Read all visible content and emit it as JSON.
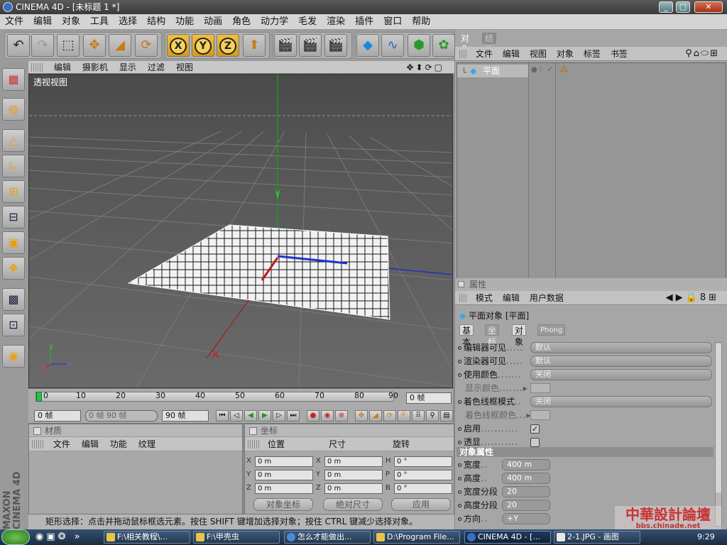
{
  "window": {
    "title": "CINEMA 4D - [未标题 1 *]"
  },
  "menubar": [
    "文件",
    "编辑",
    "对象",
    "工具",
    "选择",
    "结构",
    "功能",
    "动画",
    "角色",
    "动力学",
    "毛发",
    "渲染",
    "插件",
    "窗口",
    "帮助"
  ],
  "viewport": {
    "menu": [
      "编辑",
      "摄影机",
      "显示",
      "过滤",
      "视图"
    ],
    "label": "透视视图",
    "axes": {
      "x": "x",
      "y": "y",
      "z": "z"
    }
  },
  "timeline": {
    "ticks": [
      "0",
      "10",
      "20",
      "30",
      "40",
      "50",
      "60",
      "70",
      "80",
      "90"
    ],
    "current_frame": "0 帧"
  },
  "playback": {
    "start": "0 帧",
    "range": "0 帧  90 帧",
    "end": "90 帧"
  },
  "materials": {
    "title": "材质",
    "menu": [
      "文件",
      "编辑",
      "功能",
      "纹理"
    ]
  },
  "coordinates": {
    "title": "坐标",
    "headers": [
      "位置",
      "尺寸",
      "旋转"
    ],
    "rows": [
      {
        "a": "X",
        "v1": "0 m",
        "b": "X",
        "v2": "0 m",
        "c": "H",
        "v3": "0 °"
      },
      {
        "a": "Y",
        "v1": "0 m",
        "b": "Y",
        "v2": "0 m",
        "c": "P",
        "v3": "0 °"
      },
      {
        "a": "Z",
        "v1": "0 m",
        "b": "Z",
        "v2": "0 m",
        "c": "B",
        "v3": "0 °"
      }
    ],
    "mode": "对象坐标",
    "size_mode": "绝对尺寸",
    "apply": "应用"
  },
  "objects": {
    "tabs": [
      "对象",
      "结构"
    ],
    "menu": [
      "文件",
      "编辑",
      "视图",
      "对象",
      "标签",
      "书签"
    ],
    "items": [
      "平面"
    ]
  },
  "attributes": {
    "title": "属性",
    "menu": [
      "模式",
      "编辑",
      "用户数据"
    ],
    "object_title": "平面对象 [平面]",
    "tabs": [
      "基本",
      "坐标",
      "对象",
      "Phong"
    ],
    "basic": [
      {
        "label": "编辑器可见",
        "value": "默认"
      },
      {
        "label": "渲染器可见",
        "value": "默认"
      },
      {
        "label": "使用颜色",
        "value": "关闭"
      },
      {
        "label": "显示颜色"
      },
      {
        "label": "着色线框模式",
        "value": "关闭"
      },
      {
        "label": "着色线框颜色"
      },
      {
        "label": "启用",
        "value": "✓"
      },
      {
        "label": "透显"
      }
    ],
    "section": "对象属性",
    "props": [
      {
        "label": "宽度",
        "value": "400 m"
      },
      {
        "label": "高度",
        "value": "400 m"
      },
      {
        "label": "宽度分段",
        "value": "20"
      },
      {
        "label": "高度分段",
        "value": "20"
      },
      {
        "label": "方向",
        "value": "+Y"
      }
    ]
  },
  "status": "矩形选择：点击并拖动鼠标框选元素。按住 SHIFT 键增加选择对象；按住 CTRL 键减少选择对象。",
  "taskbar": {
    "items": [
      "F:\\相关教程\\...",
      "F:\\甲壳虫",
      "怎么才能做出...",
      "D:\\Program File...",
      "CINEMA 4D - [...",
      "2-1.JPG - 画图"
    ],
    "clock": "9:29"
  },
  "watermark": {
    "title": "中華設計論壇",
    "url": "bbs.chinade.net"
  },
  "brand": {
    "line1": "MAXON",
    "line2": "CINEMA 4D"
  }
}
